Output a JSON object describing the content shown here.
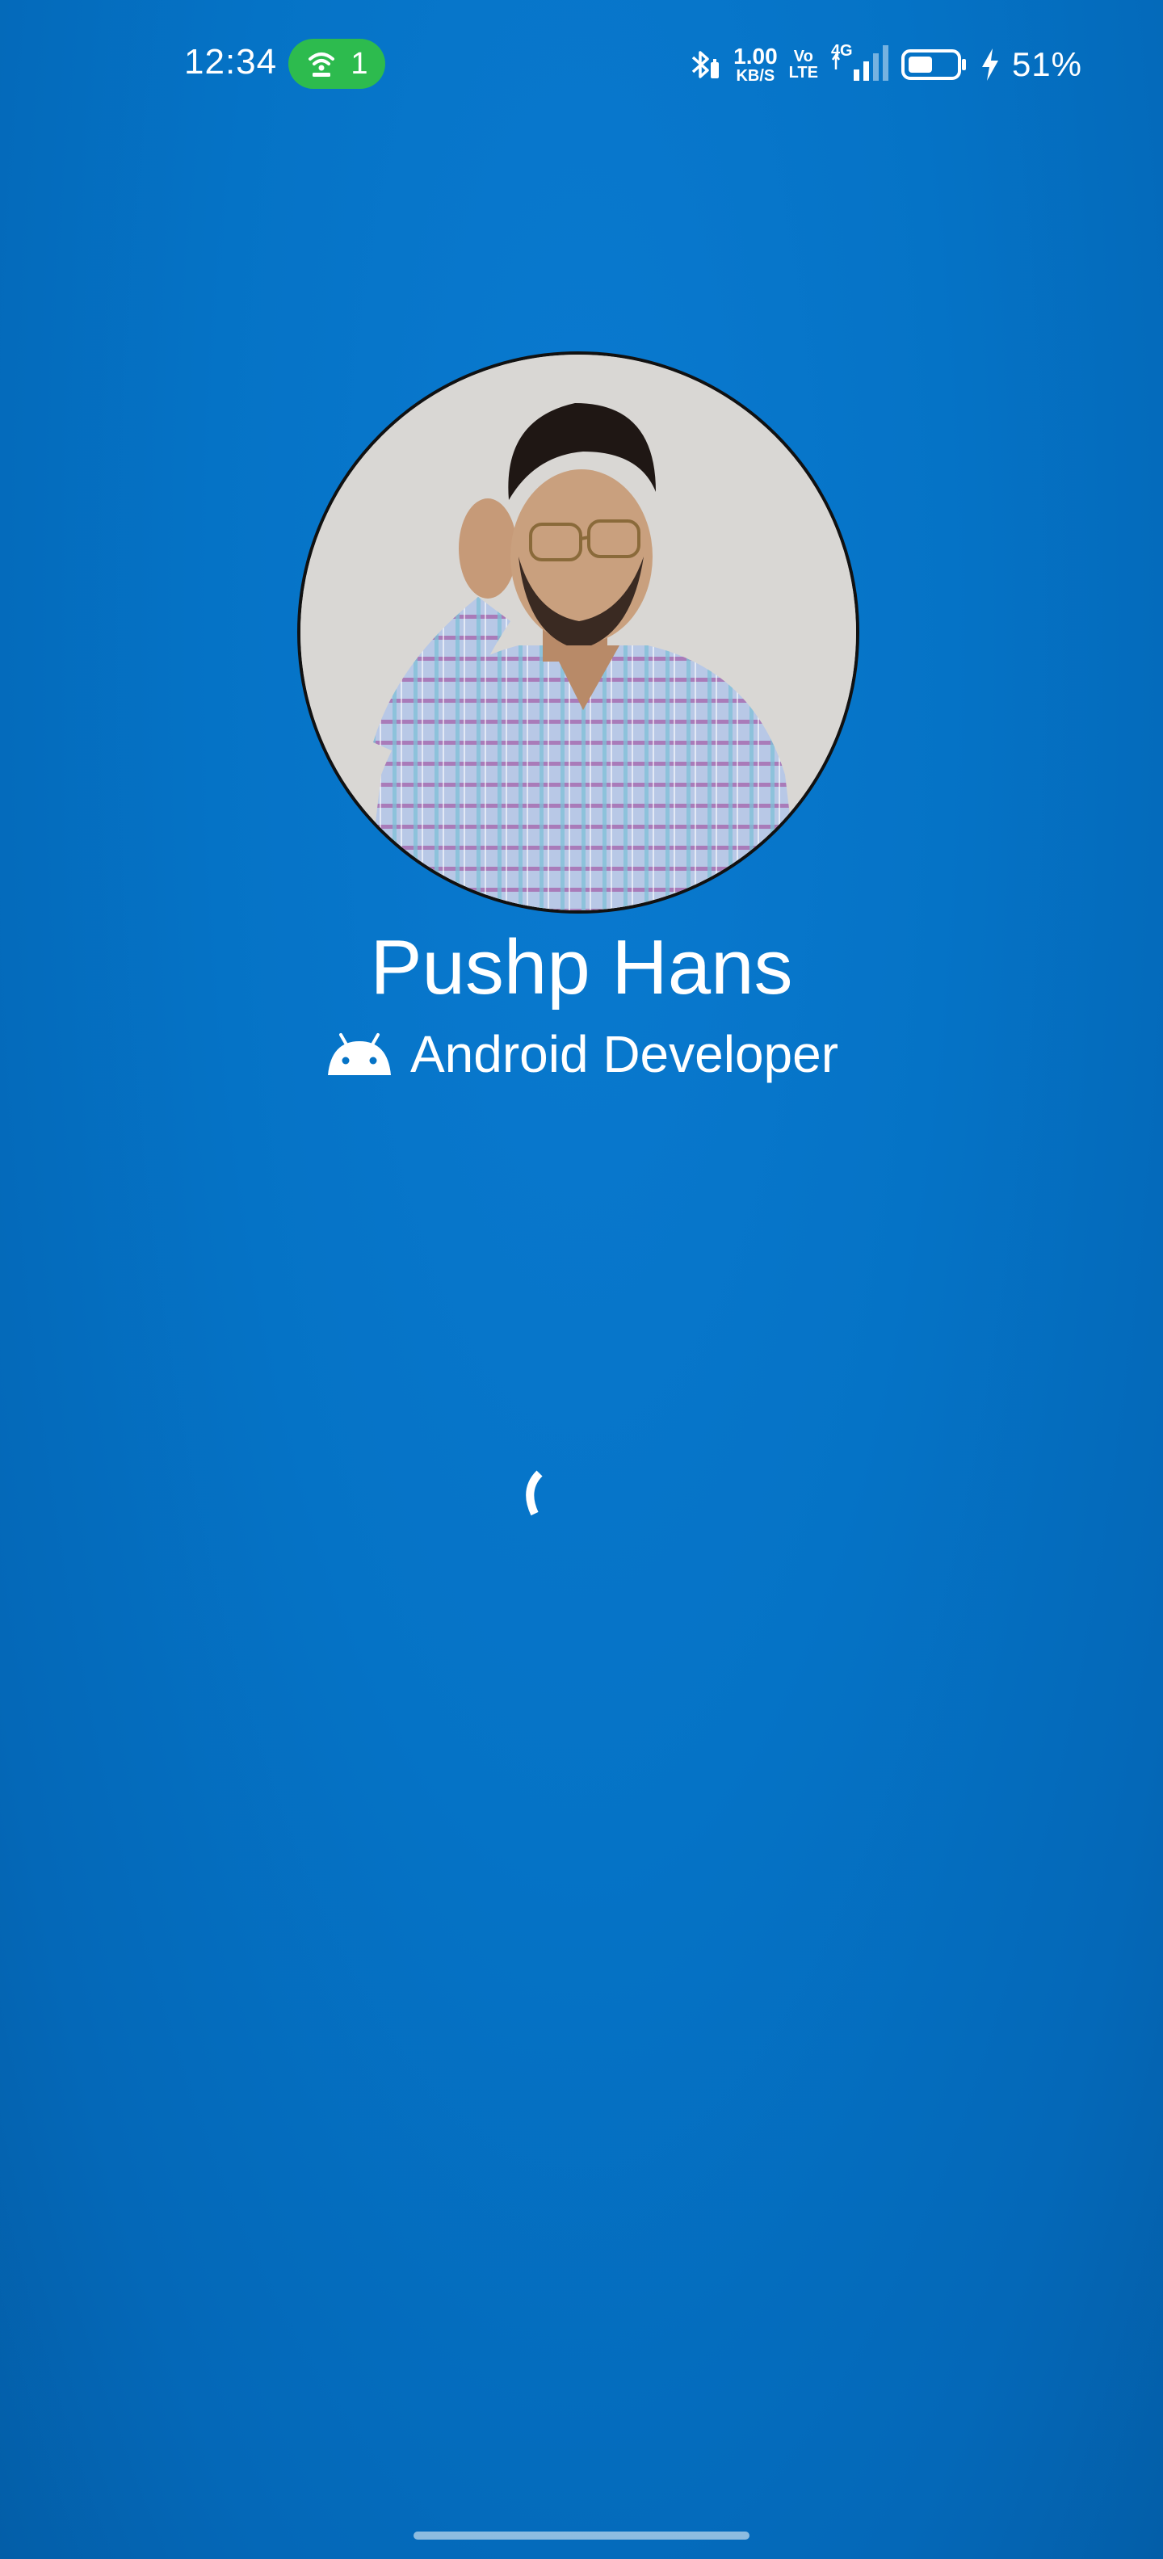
{
  "status_bar": {
    "time": "12:34",
    "hotspot_count": "1",
    "net_speed_value": "1.00",
    "net_speed_unit": "KB/S",
    "volte_top": "Vo",
    "volte_bottom": "LTE",
    "network_type": "4G",
    "battery_percent": "51%",
    "battery_level": 0.51,
    "hotspot_color": "#2dbb4e"
  },
  "profile": {
    "name": "Pushp Hans",
    "role": "Android Developer"
  },
  "colors": {
    "background": "#0573c6",
    "text": "#ffffff"
  },
  "icons": [
    "hotspot-icon",
    "bluetooth-icon",
    "signal-icon",
    "battery-icon",
    "charging-icon",
    "android-icon",
    "loading-spinner-icon"
  ]
}
